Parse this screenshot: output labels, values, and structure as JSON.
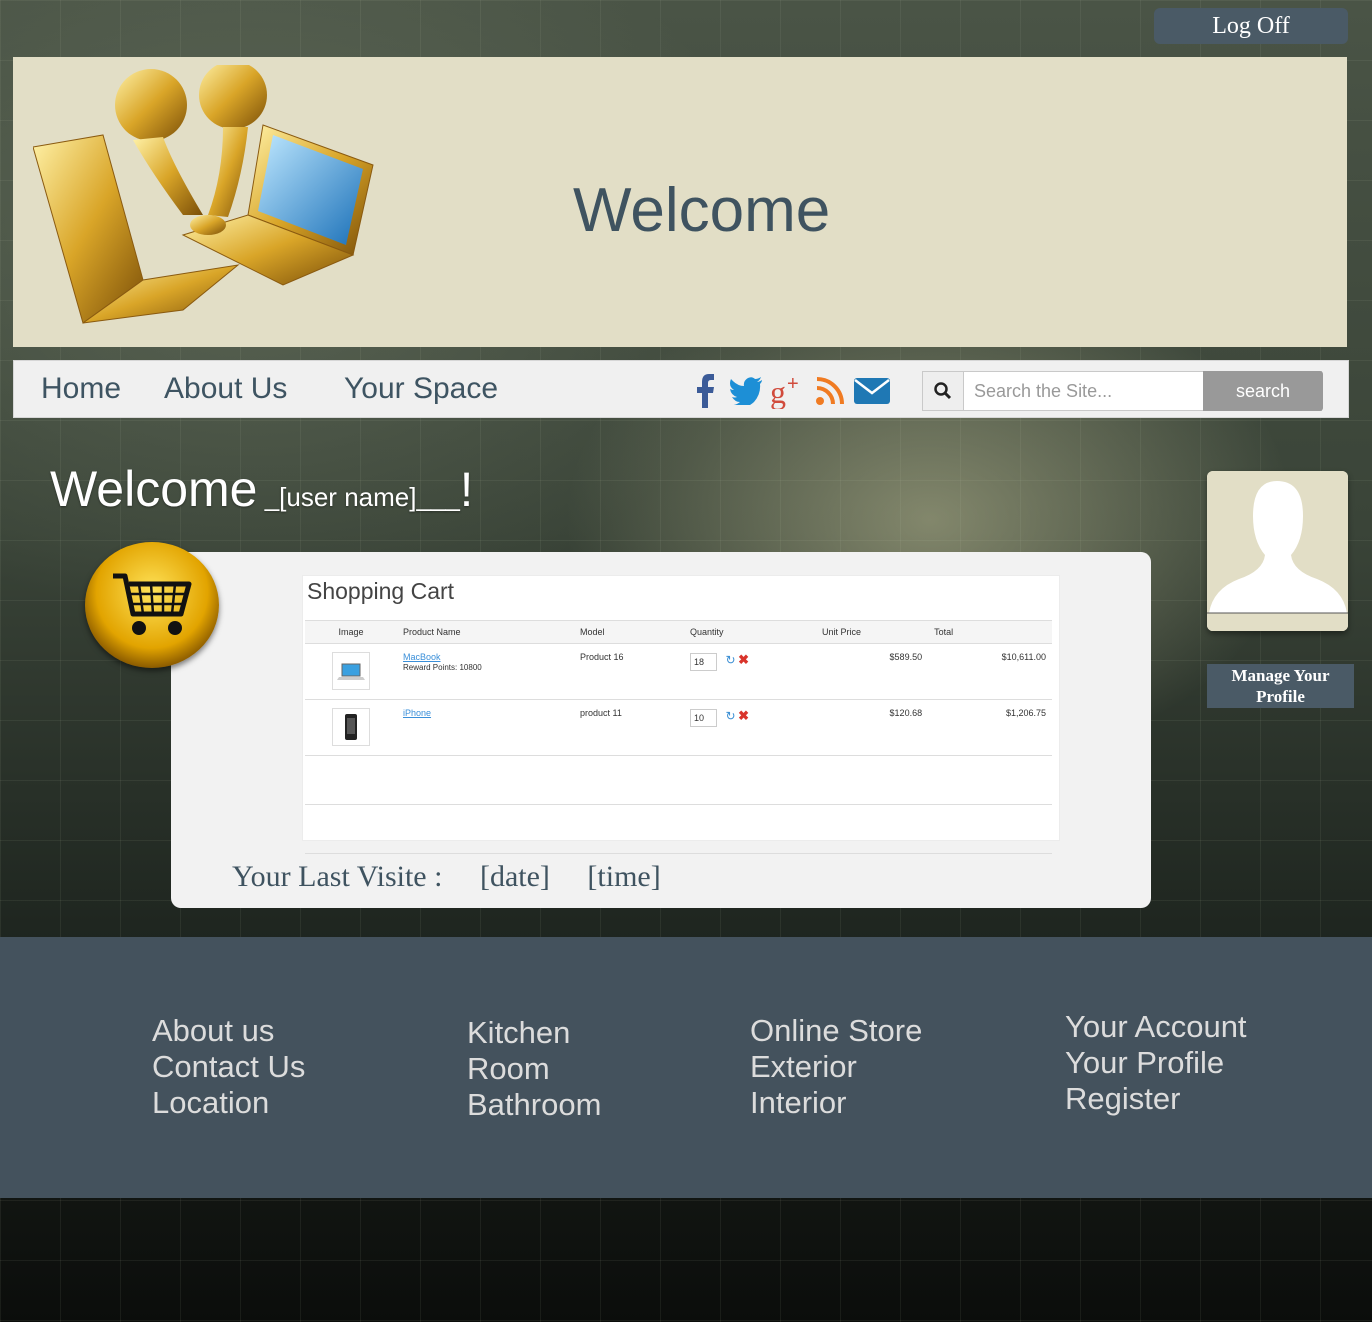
{
  "header": {
    "logoff_label": "Log Off",
    "banner_title": "Welcome"
  },
  "nav": {
    "links": [
      "Home",
      "About Us",
      "Your Space"
    ],
    "social_icons": [
      "facebook-icon",
      "twitter-icon",
      "google-plus-icon",
      "rss-icon",
      "mail-icon"
    ],
    "search_placeholder": "Search the Site...",
    "search_button": "search"
  },
  "welcome": {
    "prefix": "Welcome",
    "user": " _[user name]___",
    "suffix": "!"
  },
  "cart": {
    "title": "Shopping Cart",
    "columns": [
      "Image",
      "Product Name",
      "Model",
      "Quantity",
      "Unit Price",
      "Total"
    ],
    "rows": [
      {
        "name": "MacBook",
        "note": "Reward Points: 10800",
        "model": "Product 16",
        "qty": "18",
        "unit_price": "$589.50",
        "total": "$10,611.00"
      },
      {
        "name": "iPhone",
        "note": "",
        "model": "product 11",
        "qty": "10",
        "unit_price": "$120.68",
        "total": "$1,206.75"
      }
    ]
  },
  "last_visit": {
    "label": "Your Last Visite :",
    "date": "[date]",
    "time": "[time]"
  },
  "profile": {
    "manage_label": "Manage Your Profile"
  },
  "footer": {
    "columns": [
      [
        "About us",
        "Contact Us",
        "Location"
      ],
      [
        "Kitchen",
        "Room",
        "Bathroom"
      ],
      [
        "Online Store",
        "Exterior",
        "Interior"
      ],
      [
        "Your Account",
        "Your Profile",
        "Register"
      ]
    ]
  },
  "colors": {
    "banner_bg": "#e2dec6",
    "accent": "#3f5360",
    "footer_bg": "#44525d"
  }
}
